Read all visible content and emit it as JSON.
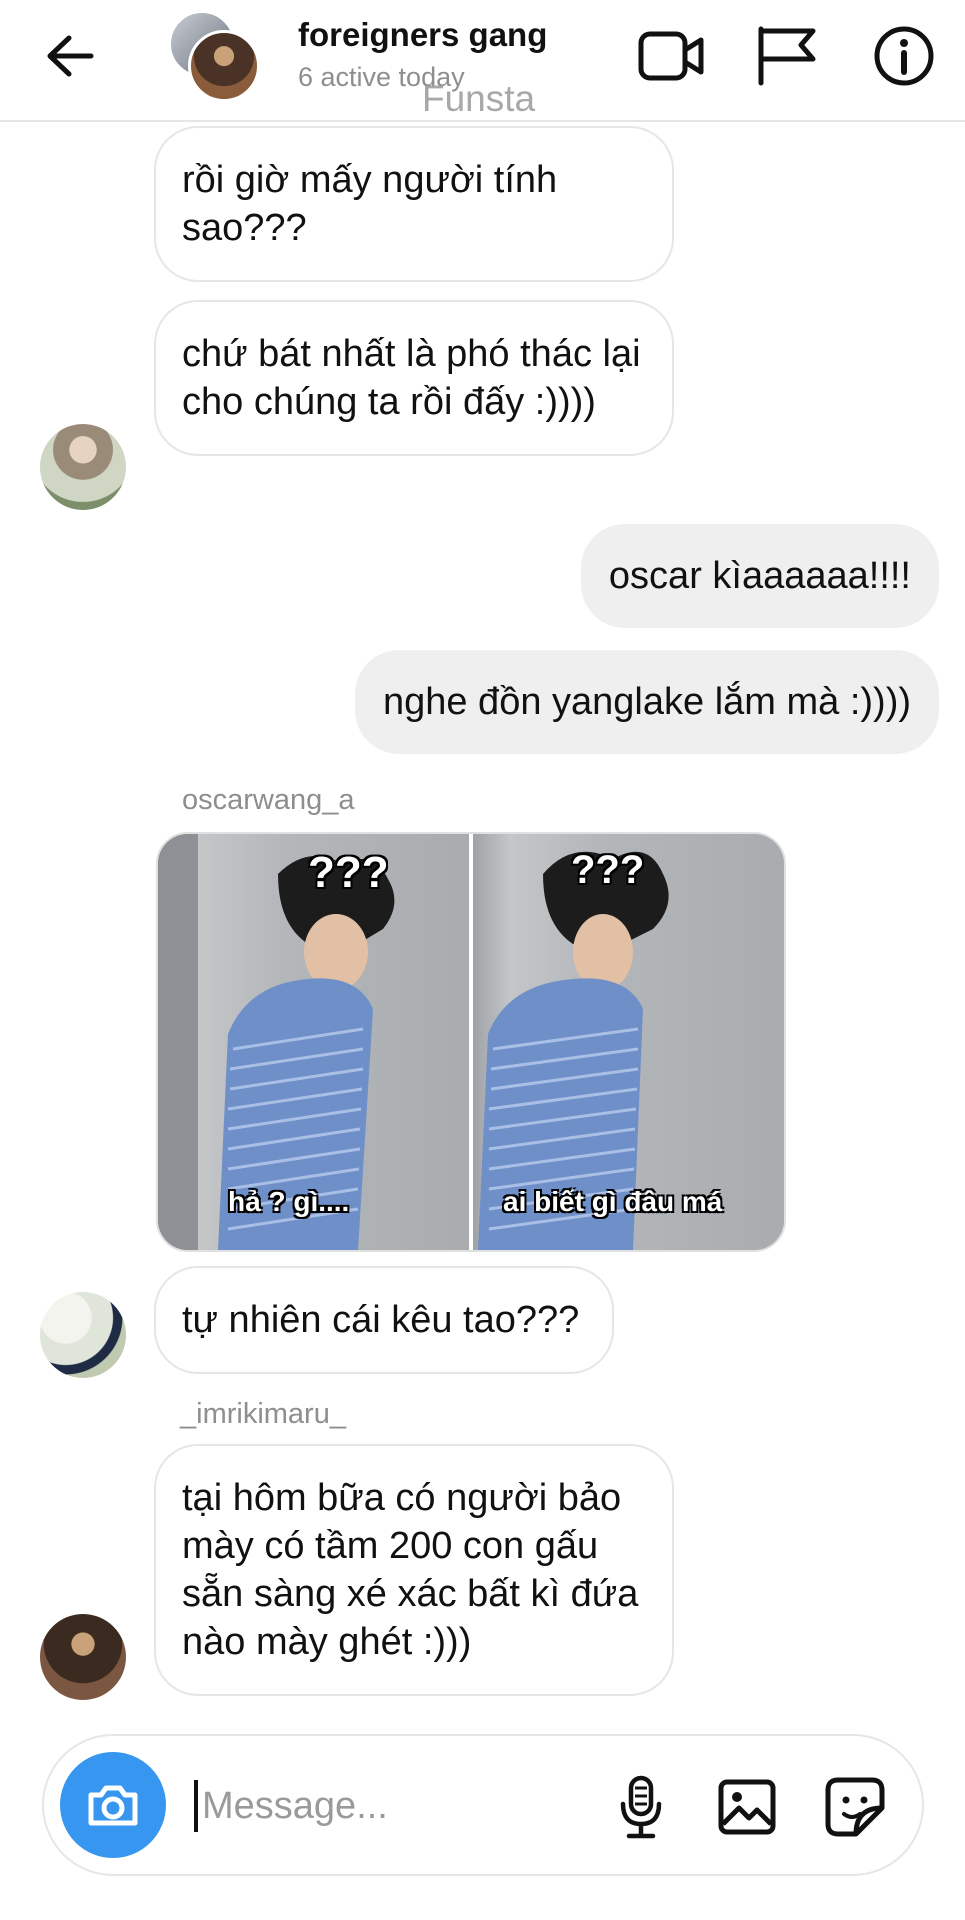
{
  "header": {
    "title": "foreigners gang",
    "subtitle": "6 active today",
    "watermark": "Funsta"
  },
  "icons": {
    "back": "back-arrow-icon",
    "video": "video-camera-icon",
    "report": "flag-icon",
    "info": "info-icon",
    "camera": "camera-icon",
    "mic": "microphone-icon",
    "gallery": "image-icon",
    "sticker": "sticker-icon"
  },
  "colors": {
    "accent": "#3797f0",
    "bubble_out": "#efefef",
    "secondary_text": "#8e8e8e"
  },
  "messages": [
    {
      "type": "incoming",
      "text": "rồi giờ mấy người tính sao???"
    },
    {
      "type": "incoming",
      "text": "chứ bát nhất là phó thác lại cho chúng ta rồi đấy :))))"
    },
    {
      "type": "outgoing",
      "text": "oscar kìaaaaaa!!!!"
    },
    {
      "type": "outgoing",
      "text": "nghe đồn yanglake lắm mà :))))"
    },
    {
      "type": "incoming_image",
      "sender": "oscarwang_a",
      "meme_top_left": "???",
      "meme_top_right": "???",
      "meme_bottom_left": "hả ? gì....",
      "meme_bottom_right": "ai biết gì đâu má"
    },
    {
      "type": "incoming",
      "text": "tự nhiên cái kêu tao???"
    },
    {
      "type": "incoming",
      "sender": "_imrikimaru_",
      "text": "tại hôm bữa có người bảo mày có tầm 200 con gấu sẵn sàng xé xác bất kì đứa nào mày ghét :)))"
    }
  ],
  "composer": {
    "placeholder": "Message..."
  }
}
